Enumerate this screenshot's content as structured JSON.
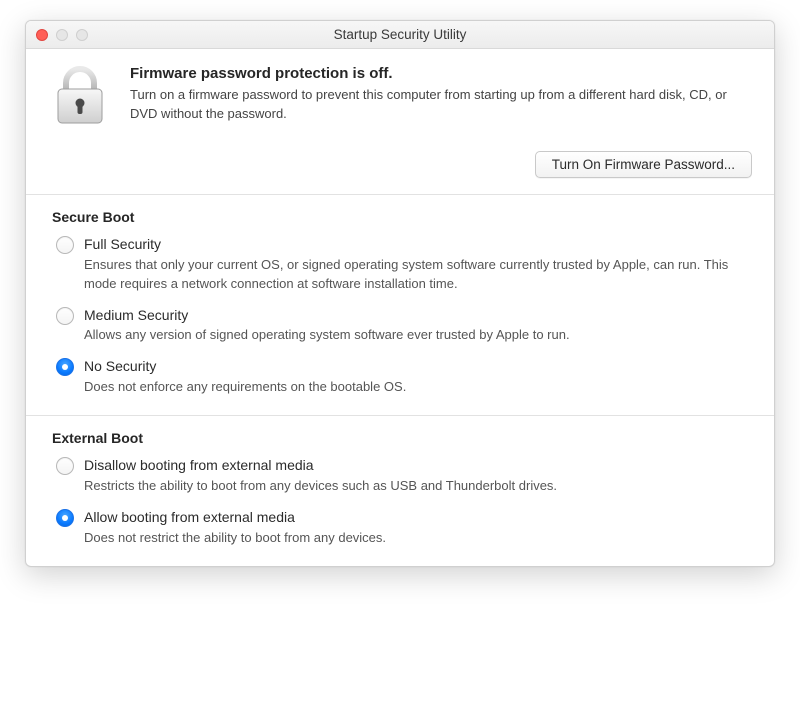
{
  "window": {
    "title": "Startup Security Utility"
  },
  "firmware": {
    "heading": "Firmware password protection is off.",
    "description": "Turn on a firmware password to prevent this computer from starting up from a different hard disk, CD, or DVD without the password.",
    "button_label": "Turn On Firmware Password..."
  },
  "secure_boot": {
    "title": "Secure Boot",
    "options": [
      {
        "label": "Full Security",
        "desc": "Ensures that only your current OS, or signed operating system software currently trusted by Apple, can run. This mode requires a network connection at software installation time.",
        "selected": false
      },
      {
        "label": "Medium Security",
        "desc": "Allows any version of signed operating system software ever trusted by Apple to run.",
        "selected": false
      },
      {
        "label": "No Security",
        "desc": "Does not enforce any requirements on the bootable OS.",
        "selected": true
      }
    ]
  },
  "external_boot": {
    "title": "External Boot",
    "options": [
      {
        "label": "Disallow booting from external media",
        "desc": "Restricts the ability to boot from any devices such as USB and Thunderbolt drives.",
        "selected": false
      },
      {
        "label": "Allow booting from external media",
        "desc": "Does not restrict the ability to boot from any devices.",
        "selected": true
      }
    ]
  }
}
